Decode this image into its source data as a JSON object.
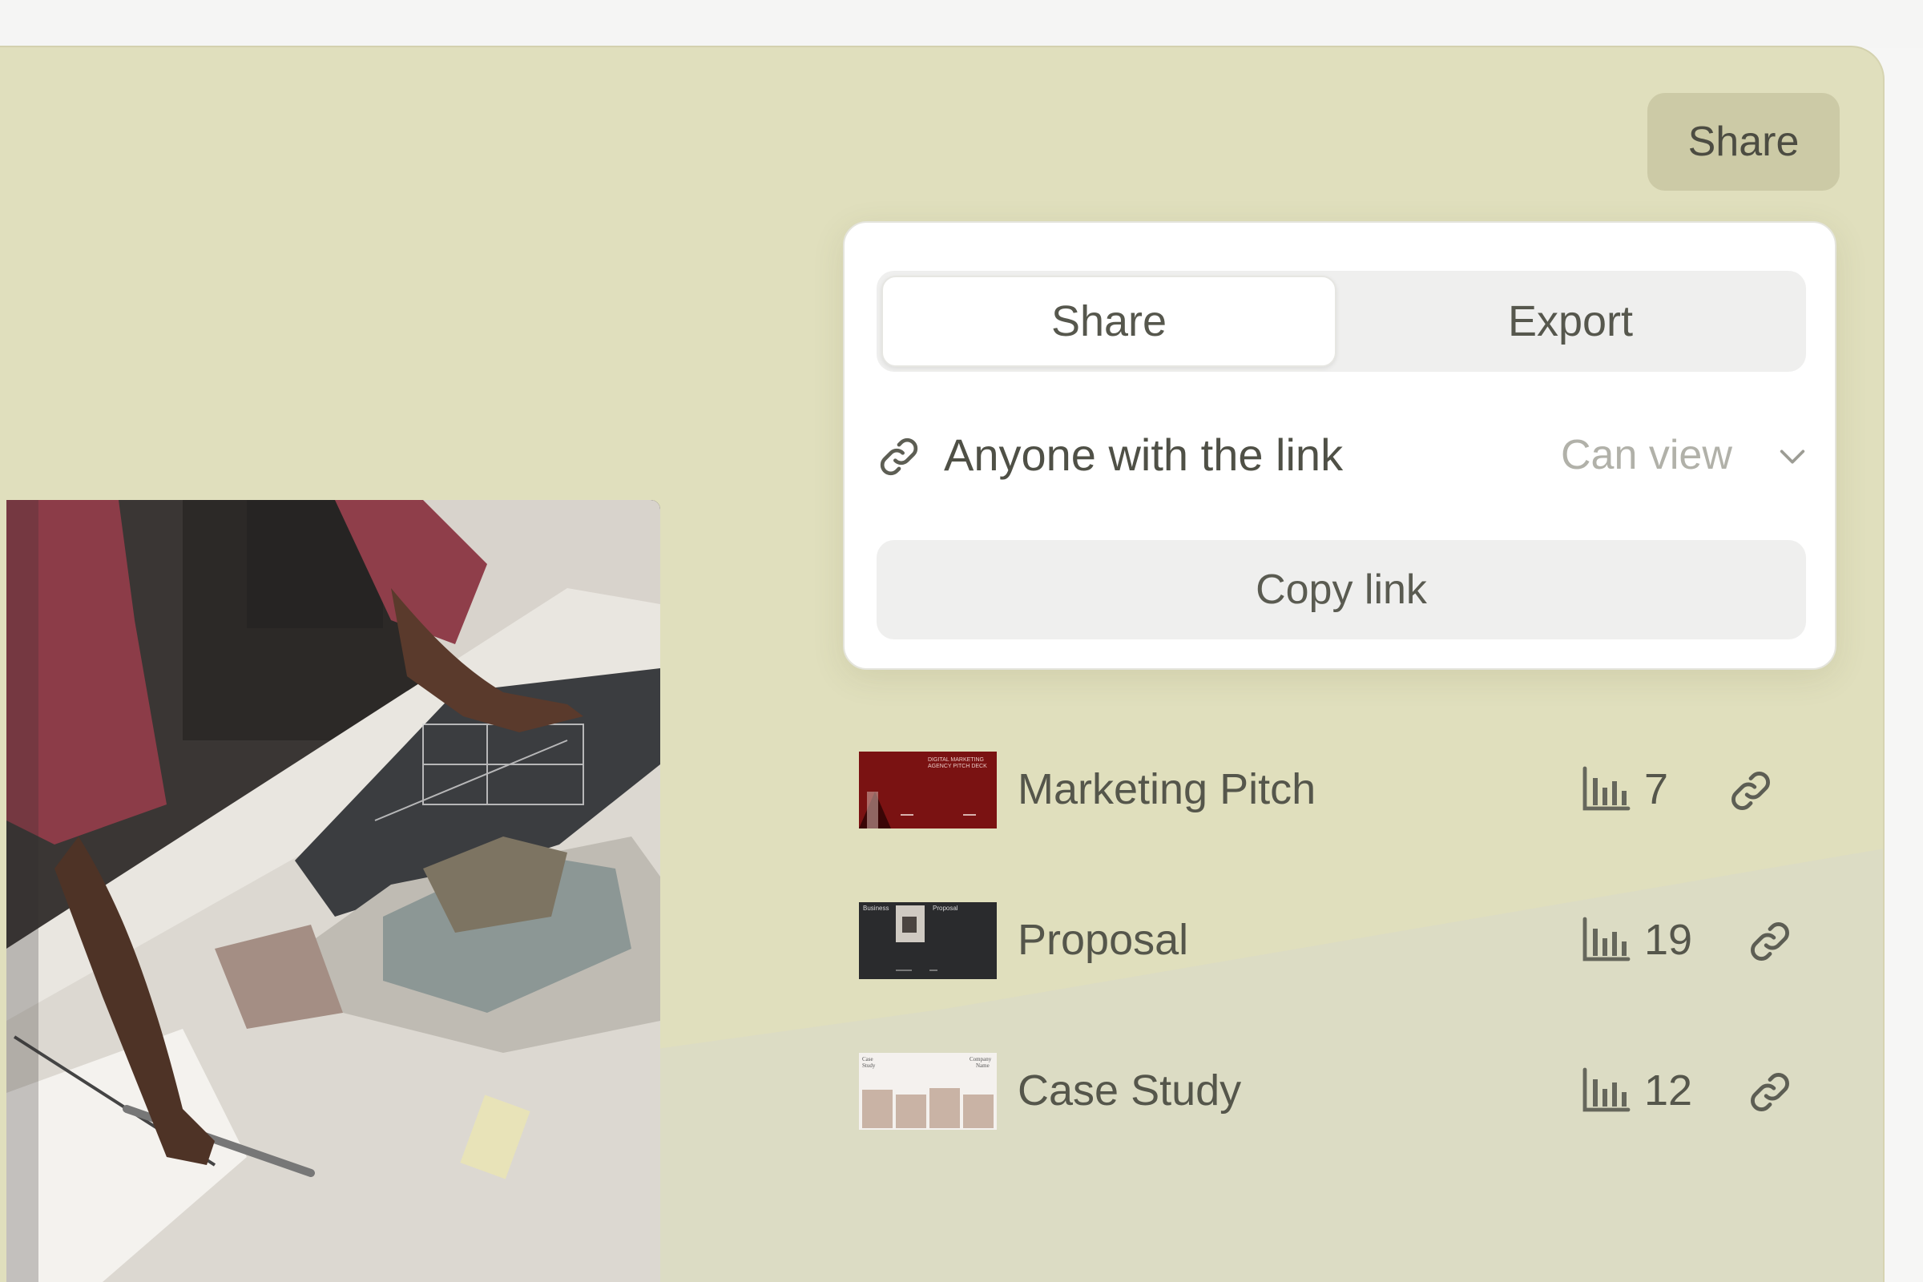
{
  "header": {
    "share_button_label": "Share"
  },
  "share_panel": {
    "tabs": [
      {
        "label": "Share",
        "active": true
      },
      {
        "label": "Export",
        "active": false
      }
    ],
    "access": {
      "label": "Anyone with the link",
      "permission": "Can view",
      "icon": "link-icon"
    },
    "copy_button_label": "Copy link"
  },
  "documents": [
    {
      "title": "Marketing Pitch",
      "views": "7",
      "thumb_color": "#7a1212",
      "thumb_text": "DIGITAL MARKETING AGENCY PITCH DECK"
    },
    {
      "title": "Proposal",
      "views": "19",
      "thumb_color": "#2a2b2d",
      "thumb_text_left": "Business",
      "thumb_text_right": "Proposal"
    },
    {
      "title": "Case Study",
      "views": "12",
      "thumb_color": "#f4f1ee",
      "thumb_text_left": "Case Study",
      "thumb_text_right": "Company Name"
    }
  ],
  "colors": {
    "canvas": "#e0dfbd",
    "share_button": "#cccaa6",
    "panel": "#ffffff",
    "muted_text": "#b1b1a9"
  }
}
